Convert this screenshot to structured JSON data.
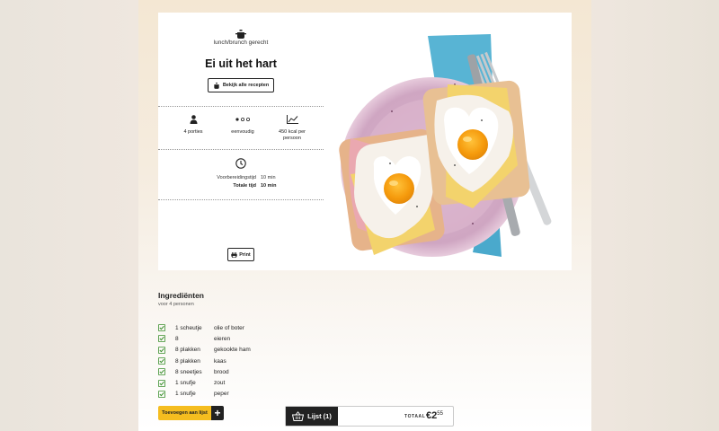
{
  "recipe": {
    "category": "lunch/brunch gerecht",
    "title": "Ei uit het hart",
    "all_recipes_label": "Bekijk alle recepten",
    "stats": [
      {
        "icon": "person-icon",
        "label": "4 porties"
      },
      {
        "icon": "dots-icon",
        "label": "eenvoudig"
      },
      {
        "icon": "chart-icon",
        "label": "450 kcal per persoon"
      }
    ],
    "times": {
      "prep_label": "Voorbereidingstijd",
      "prep_value": "10 min",
      "total_label": "Totale tijd",
      "total_value": "10 min"
    },
    "print_label": "Print"
  },
  "ingredients": {
    "title": "Ingrediënten",
    "subtitle": "voor 4 personen",
    "items": [
      {
        "qty": "1 scheutje",
        "name": "olie of boter"
      },
      {
        "qty": "8",
        "name": "eieren"
      },
      {
        "qty": "8 plakken",
        "name": "gekookte ham"
      },
      {
        "qty": "8 plakken",
        "name": "kaas"
      },
      {
        "qty": "8 sneetjes",
        "name": "brood"
      },
      {
        "qty": "1 snufje",
        "name": "zout"
      },
      {
        "qty": "1 snufje",
        "name": "peper"
      }
    ],
    "add_label": "Toevoegen aan lijst"
  },
  "cart": {
    "list_label": "Lijst (1)",
    "total_label": "TOTAAL",
    "price_main": "€2",
    "price_cents": "55"
  },
  "colors": {
    "accent": "#f5bd1f",
    "check": "#3a8f2d",
    "dark": "#222222"
  }
}
